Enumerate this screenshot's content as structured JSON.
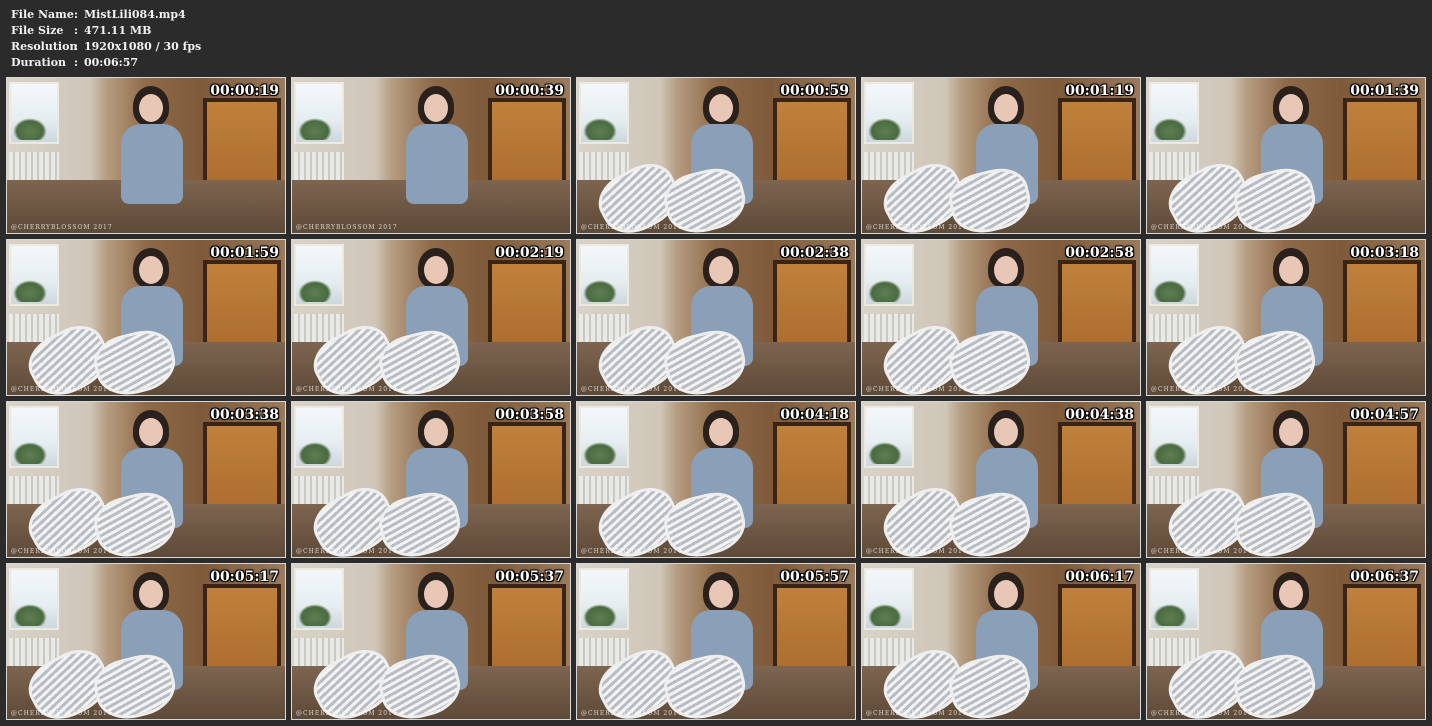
{
  "info": {
    "file_name_label": "File Name",
    "file_name": "MistLili084.mp4",
    "file_size_label": "File Size",
    "file_size": "471.11 MB",
    "resolution_label": "Resolution",
    "resolution": "1920x1080 / 30 fps",
    "duration_label": "Duration",
    "duration": "00:06:57",
    "separator": ":"
  },
  "thumbnails": [
    {
      "time": "00:00:19",
      "shoes": false
    },
    {
      "time": "00:00:39",
      "shoes": false
    },
    {
      "time": "00:00:59",
      "shoes": true
    },
    {
      "time": "00:01:19",
      "shoes": true
    },
    {
      "time": "00:01:39",
      "shoes": true
    },
    {
      "time": "00:01:59",
      "shoes": true
    },
    {
      "time": "00:02:19",
      "shoes": true
    },
    {
      "time": "00:02:38",
      "shoes": true
    },
    {
      "time": "00:02:58",
      "shoes": true
    },
    {
      "time": "00:03:18",
      "shoes": true
    },
    {
      "time": "00:03:38",
      "shoes": true
    },
    {
      "time": "00:03:58",
      "shoes": true
    },
    {
      "time": "00:04:18",
      "shoes": true
    },
    {
      "time": "00:04:38",
      "shoes": true
    },
    {
      "time": "00:04:57",
      "shoes": true
    },
    {
      "time": "00:05:17",
      "shoes": true
    },
    {
      "time": "00:05:37",
      "shoes": true
    },
    {
      "time": "00:05:57",
      "shoes": true
    },
    {
      "time": "00:06:17",
      "shoes": true
    },
    {
      "time": "00:06:37",
      "shoes": true
    }
  ],
  "watermark": "@CHERRYBLOSSOM 2017"
}
